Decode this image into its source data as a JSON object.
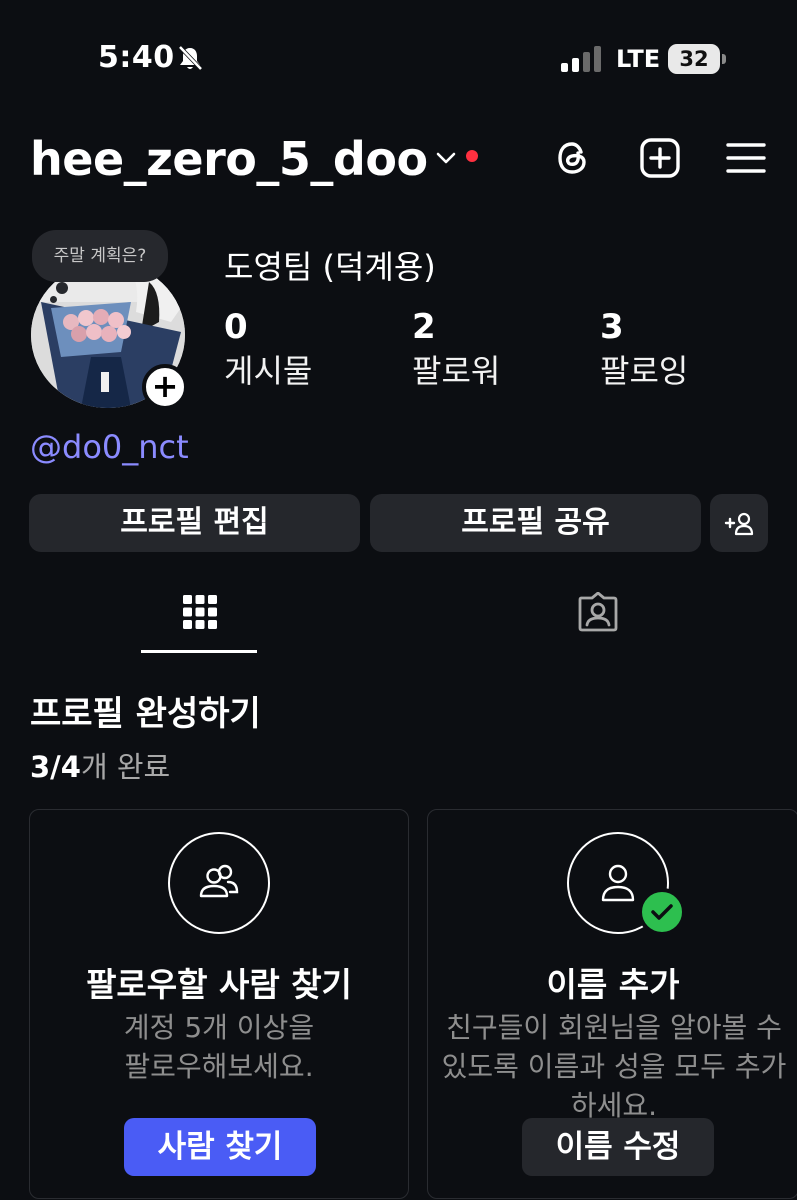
{
  "status_bar": {
    "time": "5:40",
    "network": "LTE",
    "battery": "32"
  },
  "header": {
    "username": "hee_zero_5_doo",
    "icons": [
      "chevron-down-icon",
      "notification-dot",
      "threads-icon",
      "create-icon",
      "menu-icon"
    ],
    "notification_color": "#ff3040"
  },
  "profile": {
    "note": "주말 계획은?",
    "display_name": "도영팀 (덕계용)",
    "threads_handle": "@do0_nct",
    "stats": [
      {
        "value": "0",
        "label": "게시물"
      },
      {
        "value": "2",
        "label": "팔로워"
      },
      {
        "value": "3",
        "label": "팔로잉"
      }
    ]
  },
  "actions": {
    "edit_profile": "프로필 편집",
    "share_profile": "프로필 공유"
  },
  "tabs": {
    "selected": "grid",
    "items": [
      "grid-icon",
      "tagged-icon"
    ]
  },
  "completion": {
    "title": "프로필 완성하기",
    "progress_count": "3/4",
    "progress_suffix": "개 완료",
    "cards": [
      {
        "title": "팔로우할 사람 찾기",
        "description": "계정 5개 이상을\n팔로우해보세요.",
        "action": "사람 찾기",
        "completed": false
      },
      {
        "title": "이름 추가",
        "description": "친구들이 회원님을 알아볼 수 있도록 이름과 성을 모두 추가하세요.",
        "action": "이름 수정",
        "completed": true
      }
    ]
  },
  "colors": {
    "background": "#0c0e12",
    "button": "#25272c",
    "accent": "#4a5cf5",
    "link": "#8b8bff",
    "success": "#2dbf4f"
  }
}
